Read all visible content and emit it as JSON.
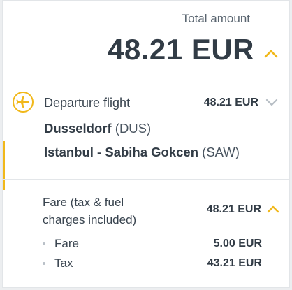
{
  "summary": {
    "total_label": "Total amount",
    "total_amount": "48.21 EUR",
    "toggle_icon": "chevron-up-icon"
  },
  "departure": {
    "icon": "plane-icon",
    "label": "Departure flight",
    "price": "48.21 EUR",
    "toggle_icon": "chevron-down-icon",
    "origin_city": "Dusseldorf",
    "origin_code": "(DUS)",
    "destination_city": "Istanbul - Sabiha Gokcen",
    "destination_code": "(SAW)"
  },
  "fare": {
    "title_line1": "Fare (tax & fuel",
    "title_line2": "charges included)",
    "price": "48.21 EUR",
    "toggle_icon": "chevron-up-icon",
    "breakdown": [
      {
        "label": "Fare",
        "value": "5.00 EUR"
      },
      {
        "label": "Tax",
        "value": "43.21 EUR"
      }
    ]
  },
  "colors": {
    "accent": "#f1b81a",
    "text_dark": "#323c46",
    "chevron_gray": "#b6bdc4",
    "divider": "#e3e6e9"
  }
}
